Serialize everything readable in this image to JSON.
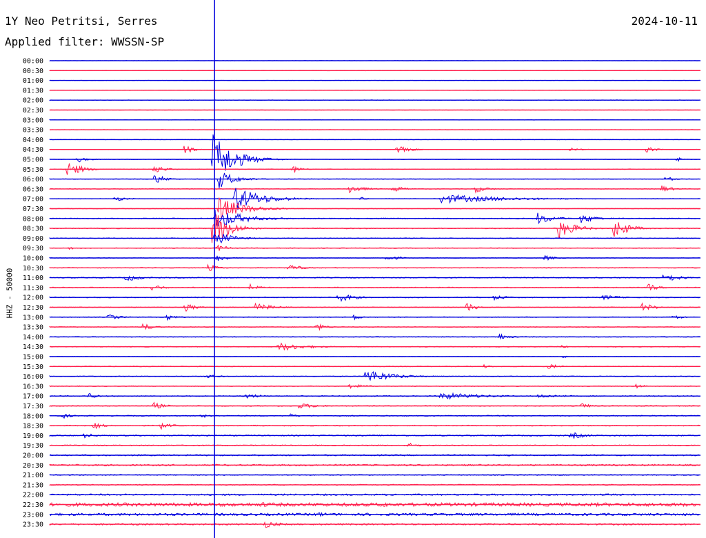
{
  "header": {
    "station": "1Y Neo Petritsi, Serres",
    "date": "2024-10-11",
    "filter": "Applied filter: WWSSN-SP"
  },
  "colors": {
    "odd_trace": "#0000dd",
    "even_trace": "#ff1f4d",
    "marker": "#0000dd"
  },
  "chart_data": {
    "type": "line",
    "title": "1Y Neo Petritsi, Serres",
    "subtitle": "Applied filter: WWSSN-SP",
    "date": "2024-10-11",
    "ylabel": "HHZ - 50000",
    "xlabel": "",
    "grid": false,
    "x_unit": "minutes into 30-minute row",
    "x_range": [
      0,
      30
    ],
    "marker_minute": 7.6,
    "rows": [
      "00:00",
      "00:30",
      "01:00",
      "01:30",
      "02:00",
      "02:30",
      "03:00",
      "03:30",
      "04:00",
      "04:30",
      "05:00",
      "05:30",
      "06:00",
      "06:30",
      "07:00",
      "07:30",
      "08:00",
      "08:30",
      "09:00",
      "09:30",
      "10:00",
      "10:30",
      "11:00",
      "11:30",
      "12:00",
      "12:30",
      "13:00",
      "13:30",
      "14:00",
      "14:30",
      "15:00",
      "15:30",
      "16:00",
      "16:30",
      "17:00",
      "17:30",
      "18:00",
      "18:30",
      "19:00",
      "19:30",
      "20:00",
      "20:30",
      "21:00",
      "21:30",
      "22:00",
      "22:30",
      "23:00",
      "23:30"
    ],
    "base_noise": [
      0.2,
      0.2,
      0.15,
      0.15,
      0.3,
      0.15,
      0.2,
      0.25,
      0.2,
      0.2,
      0.3,
      0.3,
      0.3,
      0.3,
      0.3,
      0.3,
      0.5,
      0.5,
      0.4,
      0.4,
      0.3,
      0.4,
      0.5,
      0.5,
      0.5,
      0.4,
      0.4,
      0.4,
      0.4,
      0.4,
      0.3,
      0.4,
      0.4,
      0.4,
      0.5,
      0.5,
      0.5,
      0.5,
      0.6,
      0.5,
      0.7,
      0.8,
      0.5,
      0.5,
      0.8,
      1.8,
      1.2,
      0.8
    ],
    "events": [
      {
        "row": 9,
        "minute": 6.2,
        "amp": 7,
        "dur": 0.7
      },
      {
        "row": 9,
        "minute": 16.0,
        "amp": 4,
        "dur": 1.3
      },
      {
        "row": 9,
        "minute": 24.0,
        "amp": 2,
        "dur": 1.0
      },
      {
        "row": 9,
        "minute": 27.5,
        "amp": 3,
        "dur": 1.0
      },
      {
        "row": 10,
        "minute": 1.2,
        "amp": 4,
        "dur": 1.0
      },
      {
        "row": 10,
        "minute": 7.5,
        "amp": 28,
        "dur": 2.0
      },
      {
        "row": 10,
        "minute": 28.9,
        "amp": 3,
        "dur": 0.6
      },
      {
        "row": 11,
        "minute": 0.8,
        "amp": 10,
        "dur": 1.2
      },
      {
        "row": 11,
        "minute": 4.8,
        "amp": 5,
        "dur": 1.0
      },
      {
        "row": 11,
        "minute": 11.2,
        "amp": 5,
        "dur": 0.7
      },
      {
        "row": 12,
        "minute": 4.8,
        "amp": 6,
        "dur": 1.0
      },
      {
        "row": 12,
        "minute": 7.8,
        "amp": 10,
        "dur": 1.5
      },
      {
        "row": 12,
        "minute": 28.4,
        "amp": 4,
        "dur": 0.6
      },
      {
        "row": 13,
        "minute": 13.8,
        "amp": 5,
        "dur": 1.3
      },
      {
        "row": 13,
        "minute": 15.8,
        "amp": 4,
        "dur": 1.1
      },
      {
        "row": 13,
        "minute": 19.6,
        "amp": 4,
        "dur": 1.2
      },
      {
        "row": 13,
        "minute": 28.2,
        "amp": 4,
        "dur": 1.0
      },
      {
        "row": 14,
        "minute": 3.0,
        "amp": 3,
        "dur": 1.0
      },
      {
        "row": 14,
        "minute": 8.5,
        "amp": 14,
        "dur": 2.5
      },
      {
        "row": 14,
        "minute": 14.3,
        "amp": 2,
        "dur": 0.6
      },
      {
        "row": 14,
        "minute": 18.0,
        "amp": 5,
        "dur": 6.0
      },
      {
        "row": 15,
        "minute": 7.8,
        "amp": 12,
        "dur": 2.5
      },
      {
        "row": 16,
        "minute": 7.6,
        "amp": 12,
        "dur": 2.5
      },
      {
        "row": 16,
        "minute": 22.5,
        "amp": 6,
        "dur": 1.5
      },
      {
        "row": 16,
        "minute": 24.5,
        "amp": 5,
        "dur": 1.5
      },
      {
        "row": 17,
        "minute": 7.5,
        "amp": 22,
        "dur": 1.5
      },
      {
        "row": 17,
        "minute": 23.4,
        "amp": 12,
        "dur": 1.5
      },
      {
        "row": 17,
        "minute": 26.0,
        "amp": 12,
        "dur": 1.3
      },
      {
        "row": 18,
        "minute": 7.6,
        "amp": 9,
        "dur": 1.5
      },
      {
        "row": 19,
        "minute": 0.9,
        "amp": 2,
        "dur": 0.6
      },
      {
        "row": 19,
        "minute": 7.7,
        "amp": 4,
        "dur": 1.0
      },
      {
        "row": 20,
        "minute": 7.7,
        "amp": 4,
        "dur": 1.0
      },
      {
        "row": 20,
        "minute": 15.5,
        "amp": 4,
        "dur": 1.0
      },
      {
        "row": 20,
        "minute": 22.8,
        "amp": 3,
        "dur": 1.0
      },
      {
        "row": 21,
        "minute": 7.3,
        "amp": 4,
        "dur": 1.0
      },
      {
        "row": 21,
        "minute": 11.0,
        "amp": 4,
        "dur": 1.2
      },
      {
        "row": 22,
        "minute": 3.5,
        "amp": 4,
        "dur": 1.5
      },
      {
        "row": 22,
        "minute": 28.3,
        "amp": 5,
        "dur": 1.5
      },
      {
        "row": 23,
        "minute": 4.7,
        "amp": 4,
        "dur": 1.0
      },
      {
        "row": 23,
        "minute": 9.2,
        "amp": 4,
        "dur": 1.0
      },
      {
        "row": 23,
        "minute": 27.6,
        "amp": 4,
        "dur": 1.0
      },
      {
        "row": 24,
        "minute": 13.3,
        "amp": 5,
        "dur": 1.5
      },
      {
        "row": 24,
        "minute": 20.5,
        "amp": 3,
        "dur": 1.2
      },
      {
        "row": 24,
        "minute": 25.5,
        "amp": 3,
        "dur": 1.5
      },
      {
        "row": 25,
        "minute": 6.2,
        "amp": 5,
        "dur": 1.0
      },
      {
        "row": 25,
        "minute": 9.5,
        "amp": 5,
        "dur": 1.5
      },
      {
        "row": 25,
        "minute": 19.2,
        "amp": 5,
        "dur": 1.0
      },
      {
        "row": 25,
        "minute": 27.3,
        "amp": 5,
        "dur": 1.2
      },
      {
        "row": 26,
        "minute": 2.7,
        "amp": 3,
        "dur": 1.2
      },
      {
        "row": 26,
        "minute": 5.4,
        "amp": 3,
        "dur": 1.2
      },
      {
        "row": 26,
        "minute": 14.0,
        "amp": 3,
        "dur": 0.8
      },
      {
        "row": 26,
        "minute": 28.7,
        "amp": 3,
        "dur": 1.0
      },
      {
        "row": 27,
        "minute": 4.3,
        "amp": 4,
        "dur": 1.0
      },
      {
        "row": 27,
        "minute": 12.3,
        "amp": 4,
        "dur": 1.0
      },
      {
        "row": 28,
        "minute": 20.7,
        "amp": 4,
        "dur": 1.0
      },
      {
        "row": 29,
        "minute": 10.5,
        "amp": 5,
        "dur": 2.5
      },
      {
        "row": 29,
        "minute": 23.6,
        "amp": 2,
        "dur": 0.6
      },
      {
        "row": 30,
        "minute": 23.6,
        "amp": 2,
        "dur": 0.6
      },
      {
        "row": 31,
        "minute": 20.0,
        "amp": 2,
        "dur": 0.8
      },
      {
        "row": 31,
        "minute": 23.0,
        "amp": 3,
        "dur": 1.0
      },
      {
        "row": 32,
        "minute": 7.2,
        "amp": 2,
        "dur": 1.5
      },
      {
        "row": 32,
        "minute": 14.5,
        "amp": 8,
        "dur": 2.5
      },
      {
        "row": 33,
        "minute": 13.8,
        "amp": 3,
        "dur": 1.5
      },
      {
        "row": 33,
        "minute": 27.0,
        "amp": 3,
        "dur": 0.8
      },
      {
        "row": 34,
        "minute": 1.8,
        "amp": 4,
        "dur": 0.6
      },
      {
        "row": 34,
        "minute": 9.0,
        "amp": 3,
        "dur": 1.5
      },
      {
        "row": 34,
        "minute": 18.0,
        "amp": 4,
        "dur": 4.0
      },
      {
        "row": 34,
        "minute": 22.5,
        "amp": 2,
        "dur": 3.0
      },
      {
        "row": 35,
        "minute": 4.8,
        "amp": 4,
        "dur": 1.0
      },
      {
        "row": 35,
        "minute": 11.5,
        "amp": 3,
        "dur": 2.0
      },
      {
        "row": 35,
        "minute": 24.5,
        "amp": 3,
        "dur": 1.0
      },
      {
        "row": 36,
        "minute": 0.6,
        "amp": 3,
        "dur": 0.8
      },
      {
        "row": 36,
        "minute": 7.0,
        "amp": 2,
        "dur": 1.5
      },
      {
        "row": 36,
        "minute": 11.1,
        "amp": 2,
        "dur": 1.0
      },
      {
        "row": 37,
        "minute": 2.0,
        "amp": 4,
        "dur": 1.0
      },
      {
        "row": 37,
        "minute": 5.1,
        "amp": 4,
        "dur": 1.0
      },
      {
        "row": 38,
        "minute": 1.6,
        "amp": 3,
        "dur": 1.0
      },
      {
        "row": 38,
        "minute": 24.0,
        "amp": 4,
        "dur": 1.5
      },
      {
        "row": 39,
        "minute": 16.5,
        "amp": 3,
        "dur": 1.0
      },
      {
        "row": 44,
        "minute": 25.5,
        "amp": 2,
        "dur": 1.5
      },
      {
        "row": 45,
        "minute": 9.8,
        "amp": 3,
        "dur": 2.0
      },
      {
        "row": 45,
        "minute": 15.2,
        "amp": 3,
        "dur": 2.5
      },
      {
        "row": 46,
        "minute": 12.4,
        "amp": 3,
        "dur": 1.0
      },
      {
        "row": 46,
        "minute": 14.5,
        "amp": 2,
        "dur": 1.0
      },
      {
        "row": 47,
        "minute": 9.9,
        "amp": 4,
        "dur": 1.5
      }
    ]
  }
}
